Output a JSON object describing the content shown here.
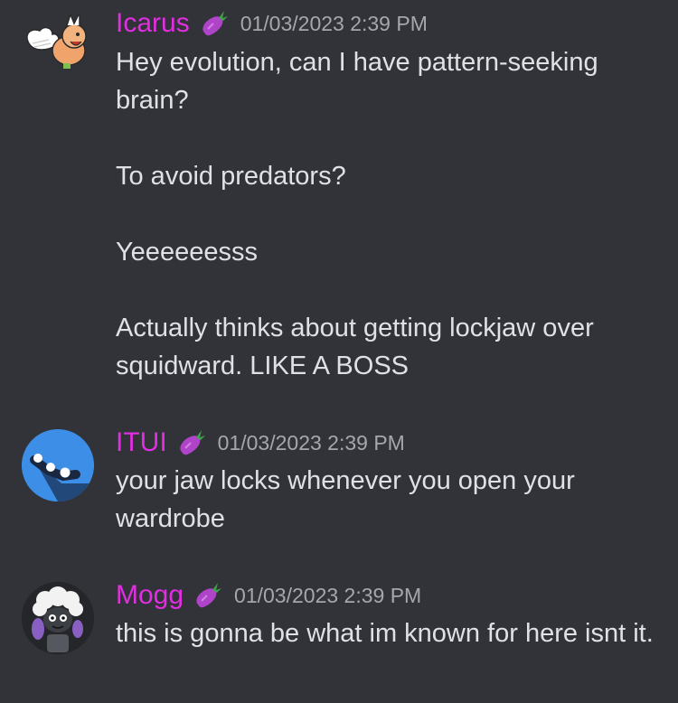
{
  "messages": [
    {
      "author": "Icarus",
      "timestamp": "01/03/2023 2:39 PM",
      "role_icon": "eggplant-icon",
      "avatar_icon": "winged-creature-avatar-icon",
      "lines": [
        "Hey evolution, can I have pattern-seeking brain?",
        "To avoid predators?",
        "Yeeeeeesss",
        "Actually thinks about getting lockjaw over squidward. LIKE A BOSS"
      ]
    },
    {
      "author": "ITUI",
      "timestamp": "01/03/2023 2:39 PM",
      "role_icon": "eggplant-icon",
      "avatar_icon": "blue-dots-avatar-icon",
      "lines": [
        "your jaw locks whenever you open your wardrobe"
      ]
    },
    {
      "author": "Mogg",
      "timestamp": "01/03/2023 2:39 PM",
      "role_icon": "eggplant-icon",
      "avatar_icon": "sheep-character-avatar-icon",
      "lines": [
        "this is gonna be what im known for here isnt it."
      ]
    }
  ],
  "colors": {
    "background": "#313338",
    "username": "#e02ee0",
    "timestamp": "#a4a7ad",
    "text": "#e0e1e5",
    "itui_avatar": "#3c8ee6"
  }
}
